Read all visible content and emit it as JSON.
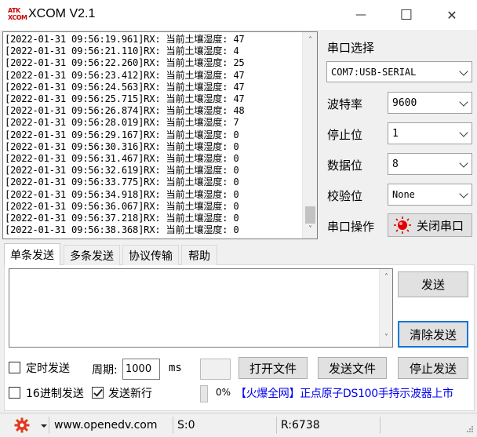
{
  "window": {
    "logo_line1": "ATK",
    "logo_line2": "XCOM",
    "title": "XCOM V2.1",
    "minimize_icon": "—",
    "maximize_icon": "☐",
    "close_icon": "✕"
  },
  "receive": {
    "lines": [
      "[2022-01-31 09:56:19.961]RX: 当前土壤湿度: 47",
      "[2022-01-31 09:56:21.110]RX: 当前土壤湿度: 4",
      "[2022-01-31 09:56:22.260]RX: 当前土壤湿度: 25",
      "[2022-01-31 09:56:23.412]RX: 当前土壤湿度: 47",
      "[2022-01-31 09:56:24.563]RX: 当前土壤湿度: 47",
      "[2022-01-31 09:56:25.715]RX: 当前土壤湿度: 47",
      "[2022-01-31 09:56:26.874]RX: 当前土壤湿度: 48",
      "[2022-01-31 09:56:28.019]RX: 当前土壤湿度: 7",
      "[2022-01-31 09:56:29.167]RX: 当前土壤湿度: 0",
      "[2022-01-31 09:56:30.316]RX: 当前土壤湿度: 0",
      "[2022-01-31 09:56:31.467]RX: 当前土壤湿度: 0",
      "[2022-01-31 09:56:32.619]RX: 当前土壤湿度: 0",
      "[2022-01-31 09:56:33.775]RX: 当前土壤湿度: 0",
      "[2022-01-31 09:56:34.918]RX: 当前土壤湿度: 0",
      "[2022-01-31 09:56:36.067]RX: 当前土壤湿度: 0",
      "[2022-01-31 09:56:37.218]RX: 当前土壤湿度: 0",
      "[2022-01-31 09:56:38.368]RX: 当前土壤湿度: 0"
    ],
    "scroll_up_icon": "˄",
    "scroll_down_icon": "˅"
  },
  "settings": {
    "port_select_label": "串口选择",
    "port_value": "COM7:USB-SERIAL",
    "baud_label": "波特率",
    "baud_value": "9600",
    "stopbits_label": "停止位",
    "stopbits_value": "1",
    "databits_label": "数据位",
    "databits_value": "8",
    "parity_label": "校验位",
    "parity_value": "None",
    "port_op_label": "串口操作",
    "close_port_label": "关闭串口"
  },
  "tabs": [
    "单条发送",
    "多条发送",
    "协议传输",
    "帮助"
  ],
  "send": {
    "send_button": "发送",
    "clear_send_button": "清除发送",
    "timed_send_label": "定时发送",
    "timed_send_checked": false,
    "period_label": "周期:",
    "period_value": "1000",
    "period_unit": "ms",
    "open_file_button": "打开文件",
    "send_file_button": "发送文件",
    "stop_send_button": "停止发送",
    "hex_send_label": "16进制发送",
    "hex_send_checked": false,
    "send_newline_label": "发送新行",
    "send_newline_checked": true,
    "progress_text": "0%",
    "ad_link": "【火爆全网】正点原子DS100手持示波器上市"
  },
  "statusbar": {
    "website": "www.openedv.com",
    "sent": "S:0",
    "received": "R:6738"
  },
  "colors": {
    "logo_red": "#cc0000",
    "focus_blue": "#0078d7",
    "link_blue": "#0000ee",
    "gear_red": "#e03a1e"
  }
}
